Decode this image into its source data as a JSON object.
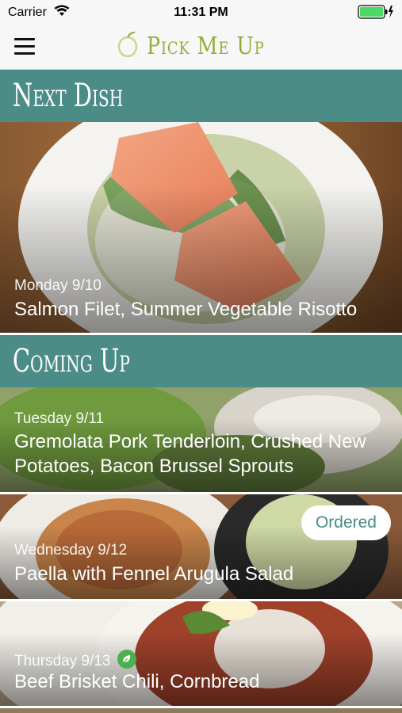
{
  "status_bar": {
    "carrier": "Carrier",
    "time": "11:31 PM"
  },
  "nav": {
    "app_title": "Pick Me Up"
  },
  "next_section": {
    "heading": "Next Dish",
    "card": {
      "date": "Monday 9/10",
      "dish": "Salmon Filet, Summer Vegetable Risotto"
    }
  },
  "upcoming_section": {
    "heading": "Coming Up",
    "cards": [
      {
        "date": "Tuesday 9/11",
        "dish": "Gremolata Pork Tenderloin, Crushed New Potatoes, Bacon Brussel Sprouts"
      },
      {
        "date": "Wednesday 9/12",
        "dish": "Paella with Fennel Arugula Salad",
        "badge": "Ordered"
      },
      {
        "date": "Thursday 9/13",
        "dish": "Beef Brisket Chili, Cornbread"
      }
    ]
  },
  "colors": {
    "accent": "#4b8c86",
    "brand": "#8fb03c"
  }
}
